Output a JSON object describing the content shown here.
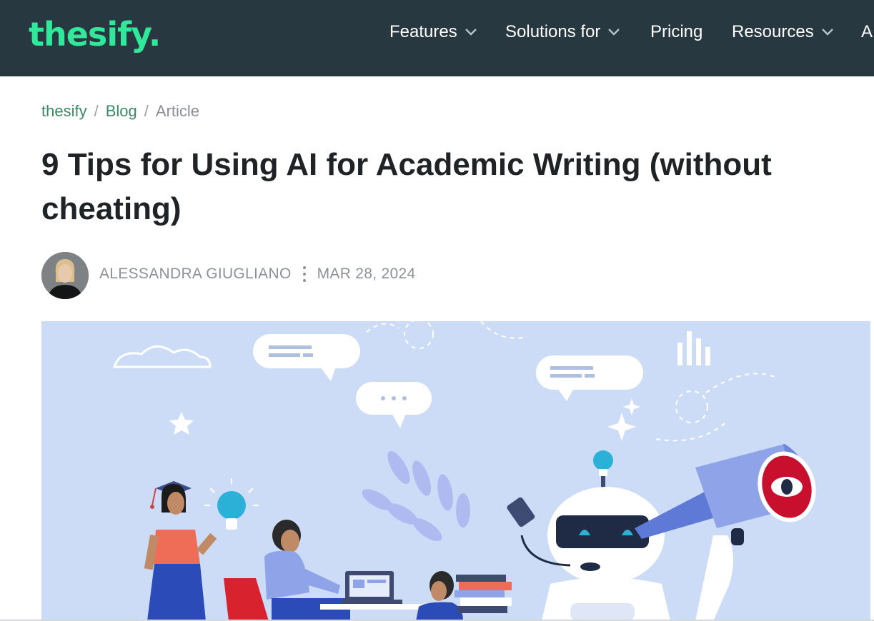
{
  "header": {
    "logo": "thesify.",
    "nav": [
      {
        "label": "Features",
        "dropdown": true
      },
      {
        "label": "Solutions for",
        "dropdown": true
      },
      {
        "label": "Pricing",
        "dropdown": false
      },
      {
        "label": "Resources",
        "dropdown": true
      },
      {
        "label": "A",
        "dropdown": false
      }
    ]
  },
  "breadcrumb": {
    "items": [
      "thesify",
      "Blog",
      "Article"
    ],
    "separator": "/"
  },
  "article": {
    "title": "9 Tips for Using AI for Academic Writing (without cheating)",
    "author": "ALESSANDRA GIUGLIANO",
    "date": "MAR 28, 2024"
  },
  "colors": {
    "header_bg": "#283840",
    "brand_green": "#2fe89a",
    "link_green": "#3b8a67",
    "hero_bg": "#cddcf6"
  }
}
